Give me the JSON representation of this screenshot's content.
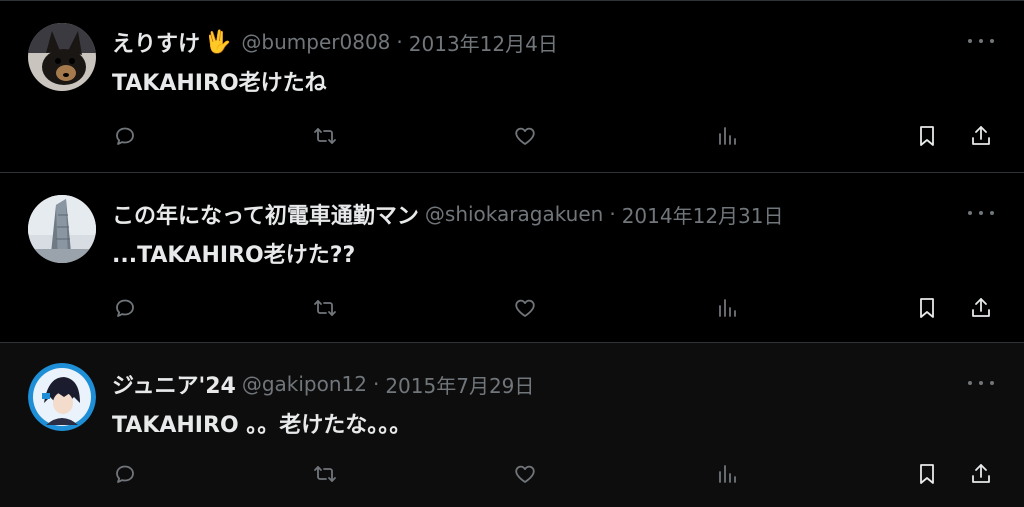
{
  "colors": {
    "background": "#000000",
    "primary_text": "#e7e9ea",
    "secondary_text": "#71767b",
    "divider": "#2f3336"
  },
  "tweets": [
    {
      "display_name": "えりすけ",
      "badge_emoji": "🖖",
      "handle": "@bumper0808",
      "separator": "·",
      "date": "2013年12月4日",
      "text": "TAKAHIRO老けたね",
      "avatar_icon": "dog-avatar"
    },
    {
      "display_name": "この年になって初電車通勤マン",
      "handle": "@shiokaragakuen",
      "separator": "·",
      "date": "2014年12月31日",
      "text": "...TAKAHIRO老けた??",
      "avatar_icon": "tower-avatar"
    },
    {
      "display_name": "ジュニア'24",
      "handle": "@gakipon12",
      "separator": "·",
      "date": "2015年7月29日",
      "text": "TAKAHIRO 。。老けたな。。。",
      "avatar_icon": "anime-avatar"
    }
  ],
  "actions": [
    "reply-icon",
    "retweet-icon",
    "like-icon",
    "views-icon",
    "bookmark-icon",
    "share-icon"
  ],
  "more_icon": "more-options-icon"
}
